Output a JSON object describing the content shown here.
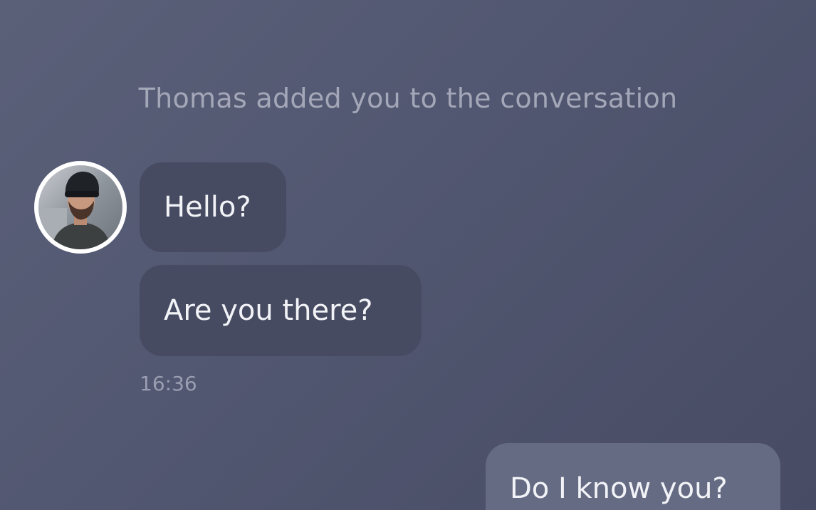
{
  "conversation": {
    "system_message": "Thomas added you to the conversation",
    "messages": [
      {
        "direction": "incoming",
        "text": "Hello?"
      },
      {
        "direction": "incoming",
        "text": "Are you there?"
      },
      {
        "direction": "outgoing",
        "text": "Do I know you?"
      }
    ],
    "incoming_timestamp": "16:36"
  },
  "avatar": {
    "icon": "user-avatar-photo"
  },
  "colors": {
    "background": "#525771",
    "incoming_bubble": "#474b61",
    "outgoing_bubble": "#666b84",
    "muted_text": "#a3a7b8"
  }
}
